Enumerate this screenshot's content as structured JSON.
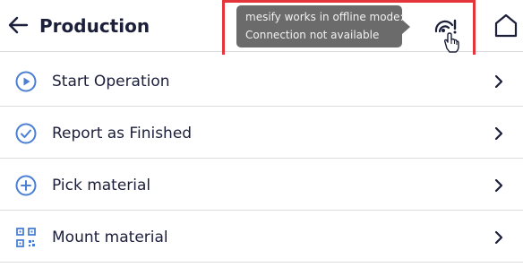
{
  "header": {
    "title": "Production",
    "back_icon": "arrow-left-icon",
    "home_icon": "home-icon",
    "offline_icon": "offline-signal-icon"
  },
  "tooltip": {
    "line1": "mesify works in offline mode:",
    "line2": "Connection not available"
  },
  "menu": {
    "items": [
      {
        "label": "Start Operation",
        "icon": "play-circle-icon"
      },
      {
        "label": "Report as Finished",
        "icon": "check-circle-icon"
      },
      {
        "label": "Pick material",
        "icon": "plus-circle-icon"
      },
      {
        "label": "Mount material",
        "icon": "qr-scan-icon"
      }
    ]
  },
  "colors": {
    "accent": "#4a7fd4",
    "text": "#1c1f3a",
    "tooltip_bg": "#6b6b6b",
    "highlight": "#e4353b"
  }
}
